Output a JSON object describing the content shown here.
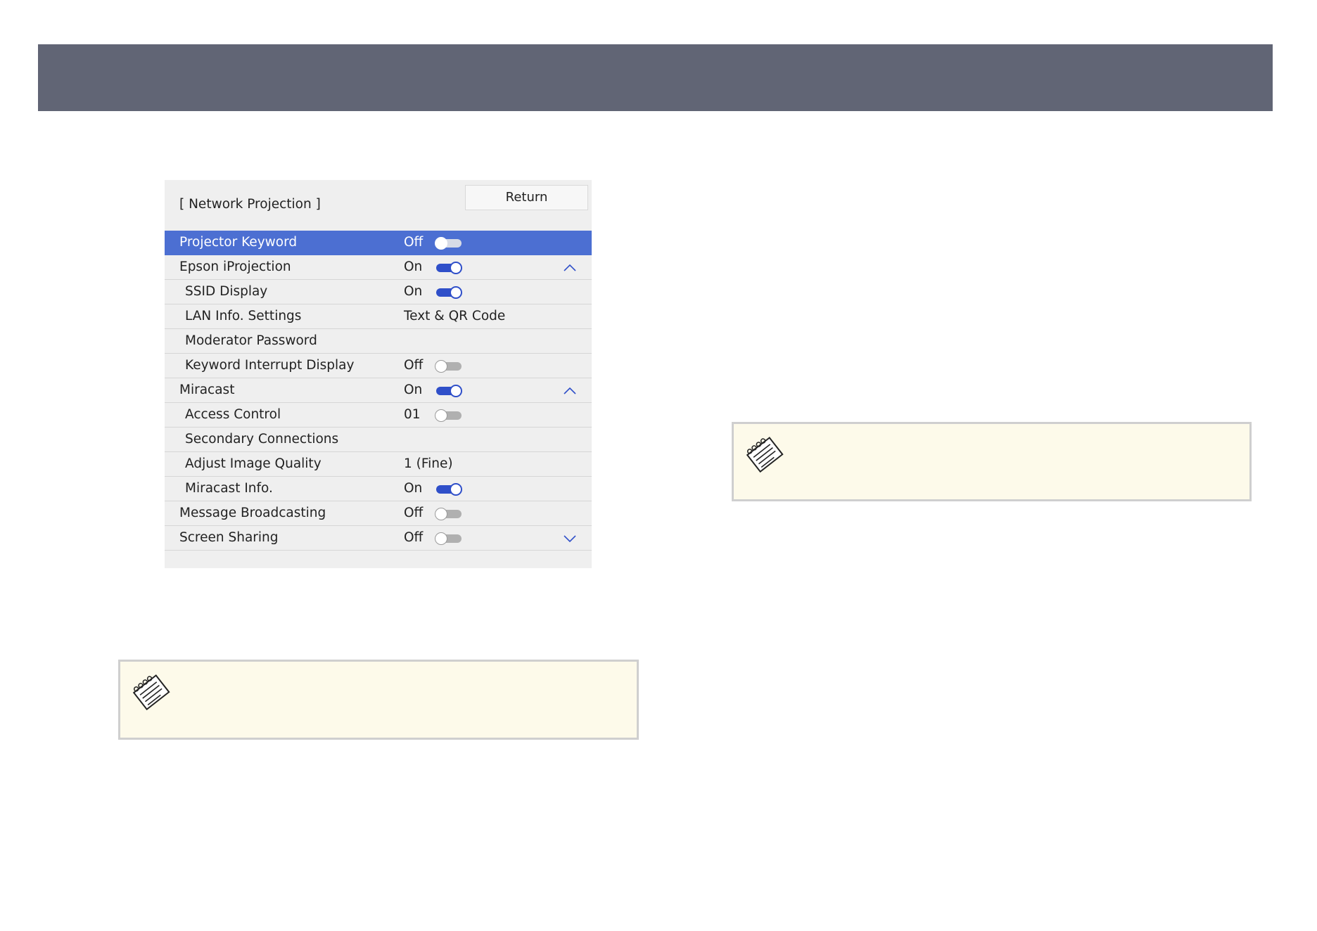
{
  "menu": {
    "title": "[ Network Projection ]",
    "return_label": "Return",
    "rows": [
      {
        "label": "Projector Keyword",
        "value": "Off",
        "toggle": "off",
        "selected": true
      },
      {
        "label": "Epson iProjection",
        "value": "On",
        "toggle": "on",
        "chevron": "up-chevron-icon"
      },
      {
        "label": "SSID Display",
        "value": "On",
        "toggle": "on"
      },
      {
        "label": "LAN Info. Settings",
        "value": "Text & QR Code"
      },
      {
        "label": "Moderator Password",
        "value": ""
      },
      {
        "label": "Keyword Interrupt Display",
        "value": "Off",
        "toggle": "off"
      },
      {
        "label": "Miracast",
        "value": "On",
        "toggle": "on",
        "chevron": "up-chevron-icon"
      },
      {
        "label": "Access Control",
        "value": "01",
        "toggle": "off"
      },
      {
        "label": "Secondary Connections",
        "value": ""
      },
      {
        "label": "Adjust Image Quality",
        "value": "1 (Fine)"
      },
      {
        "label": "Miracast Info.",
        "value": "On",
        "toggle": "on"
      },
      {
        "label": "Message Broadcasting",
        "value": "Off",
        "toggle": "off"
      },
      {
        "label": "Screen Sharing",
        "value": "Off",
        "toggle": "off",
        "chevron": "down-chevron-icon"
      }
    ]
  },
  "notes": [
    {
      "icon": "memo-note-icon"
    },
    {
      "icon": "memo-note-icon"
    }
  ],
  "colors": {
    "banner": "#616575",
    "panel": "#efefef",
    "selected_row": "#4c6fd2",
    "toggle_on": "#2f4fc9",
    "note_background": "#fdfaea"
  }
}
